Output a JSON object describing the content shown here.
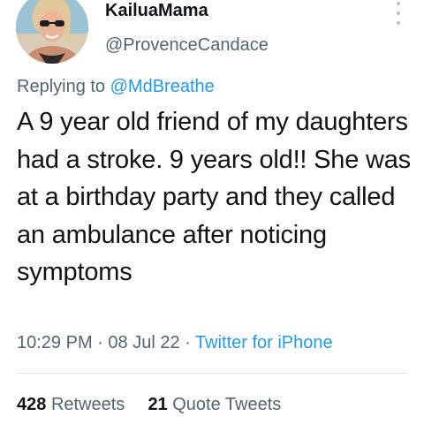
{
  "user": {
    "display_name": "KailuaMama",
    "handle": "@ProvenceCandace"
  },
  "reply": {
    "prefix": "Replying to",
    "mention": "@MdBreathe"
  },
  "tweet": {
    "text": "A 9 year old friend of my daughters had a stroke. 9 years old!! She was at a birthday party and they called an ambulance after noticing symptoms"
  },
  "meta": {
    "time": "10:29 PM",
    "separator": "·",
    "date": "08 Jul 22",
    "source": "Twitter for iPhone"
  },
  "stats": {
    "retweets_count": "428",
    "retweets_label": "Retweets",
    "quotes_count": "21",
    "quotes_label": "Quote Tweets"
  },
  "colors": {
    "link": "#1d9bf0",
    "secondary_text": "#536471",
    "primary_text": "#0f1419"
  },
  "icons": {
    "more": "more-vertical-icon"
  }
}
